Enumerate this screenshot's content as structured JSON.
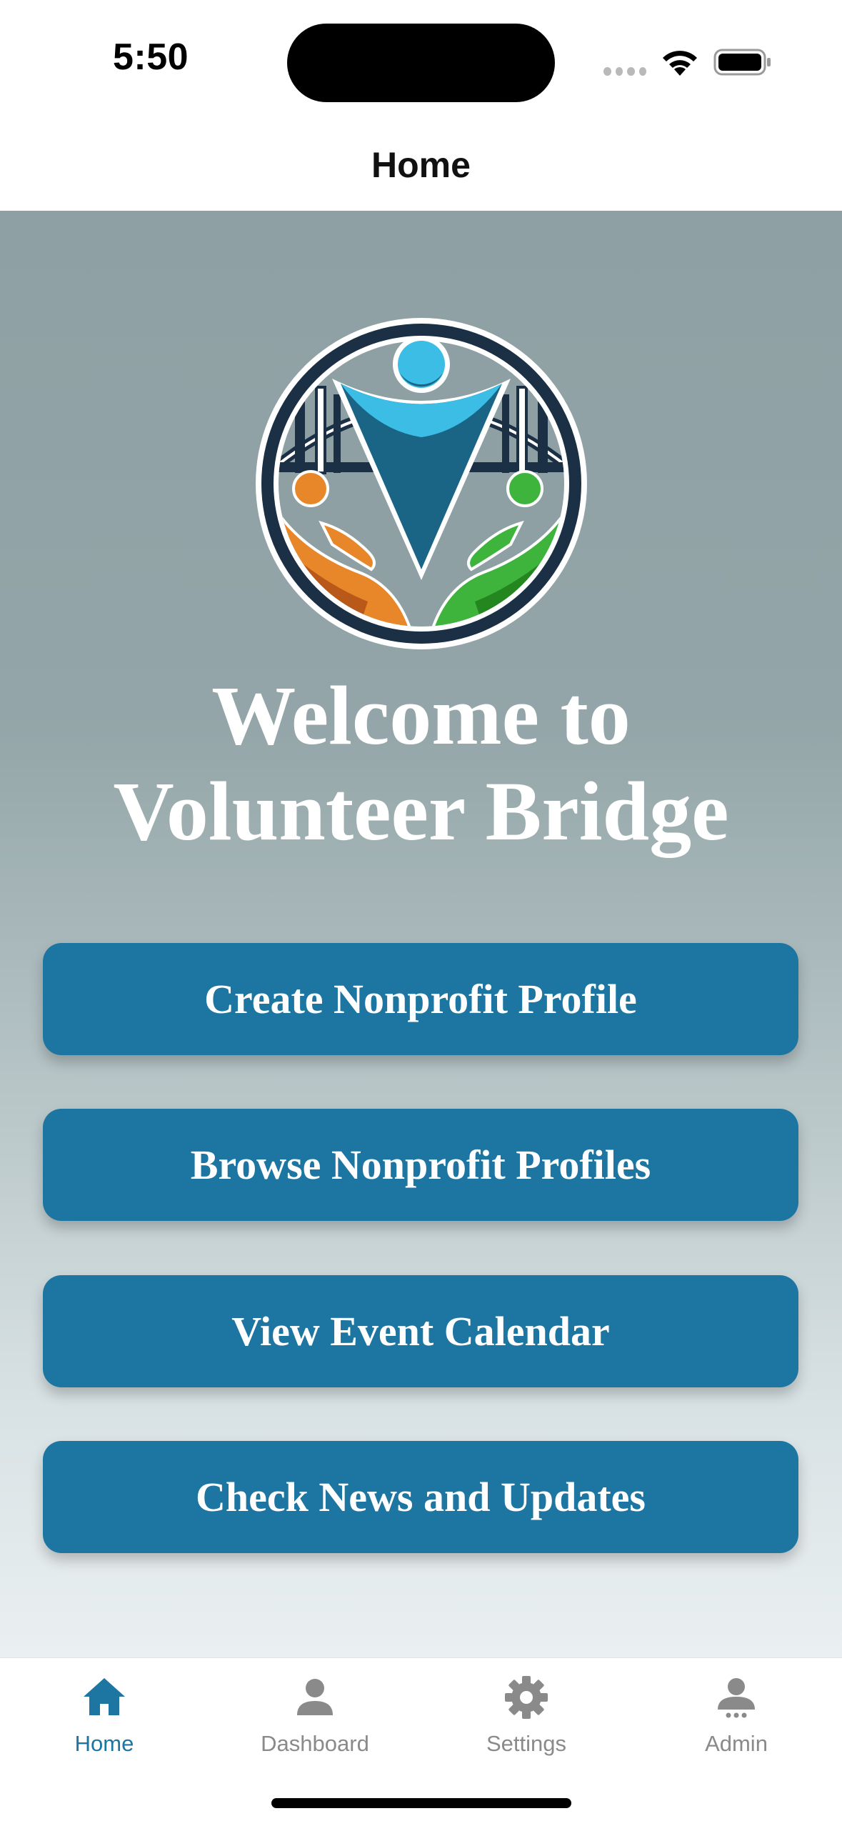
{
  "status_bar": {
    "time": "5:50"
  },
  "nav": {
    "title": "Home"
  },
  "welcome": {
    "line1": "Welcome to",
    "line2": "Volunteer Bridge"
  },
  "logo": {
    "icon": "volunteer-bridge-logo"
  },
  "actions": [
    {
      "label": "Create Nonprofit Profile"
    },
    {
      "label": "Browse Nonprofit Profiles"
    },
    {
      "label": "View Event Calendar"
    },
    {
      "label": "Check News and Updates"
    }
  ],
  "tabs": [
    {
      "label": "Home",
      "icon": "home-icon",
      "active": true
    },
    {
      "label": "Dashboard",
      "icon": "person-icon",
      "active": false
    },
    {
      "label": "Settings",
      "icon": "gear-icon",
      "active": false
    },
    {
      "label": "Admin",
      "icon": "admin-icon",
      "active": false
    }
  ],
  "colors": {
    "accent": "#1d76a2",
    "tab_inactive": "#8a8a8a",
    "background_top": "#8ea0a3",
    "background_bottom": "#eaf0f2"
  }
}
